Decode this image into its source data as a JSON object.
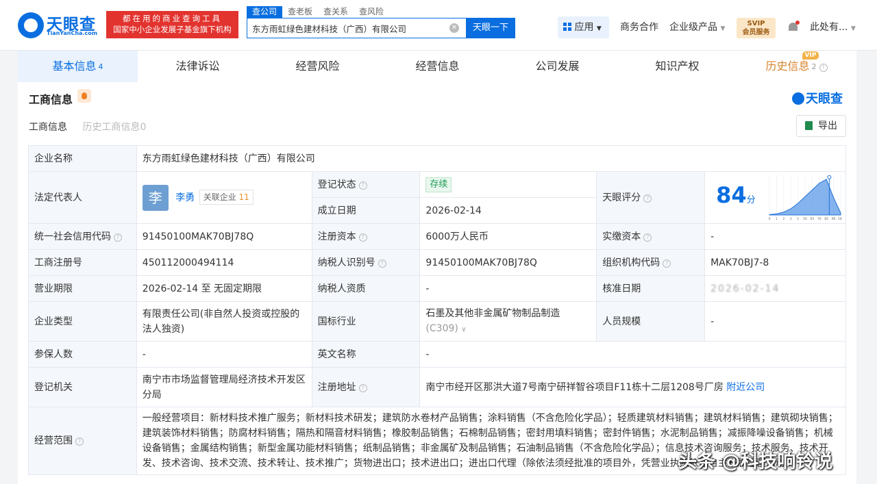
{
  "brand": {
    "cn": "天眼查",
    "en": "TianYanCha.com",
    "slogan1": "都在用的商业查询工具",
    "slogan2": "国家中小企业发展子基金旗下机构"
  },
  "search": {
    "tabs": [
      "查公司",
      "查老板",
      "查关系",
      "查风险"
    ],
    "value": "东方雨虹绿色建材科技（广西）有限公司",
    "button": "天眼一下"
  },
  "nav": {
    "app": "应用",
    "biz": "商务合作",
    "ent": "企业级产品",
    "svip1": "SVIP",
    "svip2": "会员服务",
    "user": "此处有..."
  },
  "tabs": [
    {
      "label": "基本信息",
      "count": "4"
    },
    {
      "label": "法律诉讼"
    },
    {
      "label": "经营风险"
    },
    {
      "label": "经营信息"
    },
    {
      "label": "公司发展"
    },
    {
      "label": "知识产权"
    },
    {
      "label": "历史信息",
      "count": "2"
    }
  ],
  "vip_badge": "VIP",
  "section": {
    "title": "工商信息",
    "logo": "天眼查",
    "subtab1": "工商信息",
    "subtab2": "历史工商信息0",
    "export": "导出"
  },
  "info": {
    "company_name_k": "企业名称",
    "company_name": "东方雨虹绿色建材科技（广西）有限公司",
    "legal_k": "法定代表人",
    "legal_avatar": "李",
    "legal_name": "李勇",
    "related": "关联企业",
    "related_count": "11",
    "reg_status_k": "登记状态",
    "reg_status": "存续",
    "found_k": "成立日期",
    "found": "2026-02-14",
    "score_k": "天眼评分",
    "score": "84",
    "score_unit": "分",
    "credit_k": "统一社会信用代码",
    "credit": "91450100MAK70BJ78Q",
    "capital_k": "注册资本",
    "capital": "6000万人民币",
    "paid_k": "实缴资本",
    "paid": "-",
    "regno_k": "工商注册号",
    "regno": "450112000494114",
    "tax_k": "纳税人识别号",
    "tax": "91450100MAK70BJ78Q",
    "org_k": "组织机构代码",
    "org": "MAK70BJ7-8",
    "period_k": "营业期限",
    "period": "2026-02-14 至 无固定期限",
    "taxq_k": "纳税人资质",
    "taxq": "-",
    "approve_k": "核准日期",
    "approve": "2026-02-14",
    "type_k": "企业类型",
    "type": "有限责任公司(非自然人投资或控股的法人独资)",
    "industry_k": "国标行业",
    "industry": "石墨及其他非金属矿物制品制造",
    "industry_code": "(C309)",
    "staff_k": "人员规模",
    "staff": "-",
    "insured_k": "参保人数",
    "insured": "-",
    "en_k": "英文名称",
    "en": "-",
    "auth_k": "登记机关",
    "auth": "南宁市市场监督管理局经济技术开发区分局",
    "addr_k": "注册地址",
    "addr": "南宁市经开区那洪大道7号南宁研祥智谷项目F11栋十二层1208号厂房",
    "nearby": "附近公司",
    "scope_k": "经营范围",
    "scope": "一般经营项目：新材料技术推广服务；新材料技术研发；建筑防水卷材产品销售；涂料销售（不含危险化学品）；轻质建筑材料销售；建筑材料销售；建筑砌块销售；建筑装饰材料销售；防腐材料销售；隔热和隔音材料销售；橡胶制品销售；石棉制品销售；密封用填料销售；密封件销售；水泥制品销售；减振降噪设备销售；机械设备销售；金属结构销售；新型金属功能材料销售；纸制品销售；非金属矿及制品销售；石油制品销售（不含危险化学品）；信息技术咨询服务；技术服务、技术开发、技术咨询、技术交流、技术转让、技术推广；货物进出口；技术进出口；进出口代理（除依法须经批准的项目外，凭营业执照依法自主开展经营活动）"
  },
  "chart_data": {
    "type": "area",
    "x": [
      0,
      10,
      20,
      30,
      40,
      50,
      60,
      70,
      80,
      90,
      100
    ],
    "values": [
      0.2,
      0.6,
      1.5,
      3.2,
      6,
      9.5,
      13,
      16.5,
      18.5,
      9,
      1
    ],
    "marker": 84,
    "tick_labels": [
      "0",
      "1",
      "2",
      "3",
      "5",
      "50",
      "65",
      "70",
      "85",
      "90",
      "100"
    ]
  },
  "watermark": "头条 @科技响铃说"
}
